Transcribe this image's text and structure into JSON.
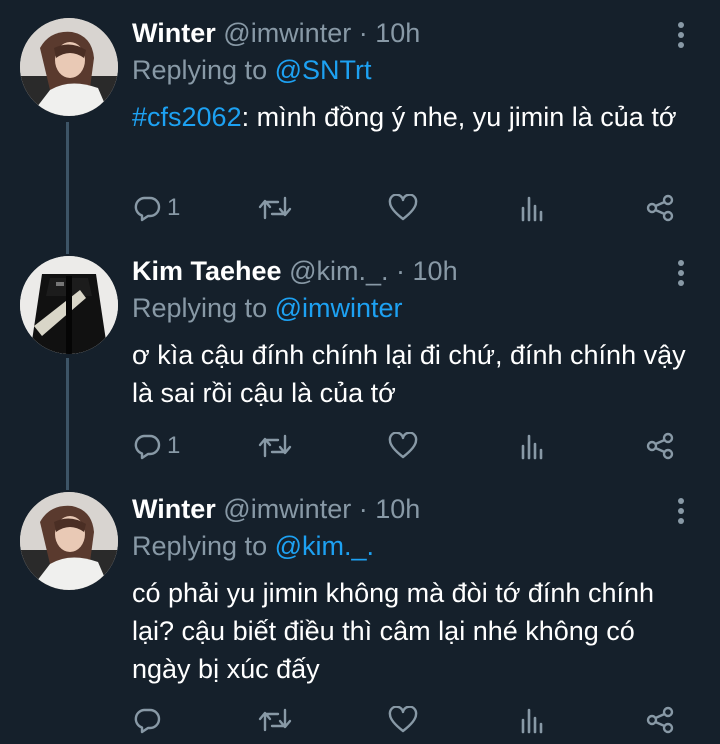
{
  "tweets": [
    {
      "name": "Winter",
      "handle": "@imwinter",
      "dot": "·",
      "time": "10h",
      "replying_prefix": "Replying to ",
      "replying_to": "@SNTrt",
      "hashtag": "#cfs2062",
      "text": ": mình đồng ý nhe, yu jimin là của tớ",
      "reply_count": "1",
      "avatar_icon": "girl-photo"
    },
    {
      "name": "Kim Taehee",
      "handle": "@kim._.",
      "dot": "·",
      "time": "10h",
      "replying_prefix": "Replying to ",
      "replying_to": "@imwinter",
      "text": "ơ kìa cậu đính chính lại đi chứ, đính chính vậy là sai rồi cậu là của tớ",
      "reply_count": "1",
      "avatar_icon": "jacket-photo"
    },
    {
      "name": "Winter",
      "handle": "@imwinter",
      "dot": "·",
      "time": "10h",
      "replying_prefix": "Replying to ",
      "replying_to": "@kim._.",
      "text": "có phải yu jimin không mà đòi tớ đính chính lại? cậu biết điều thì câm lại nhé không có ngày bị xúc đấy",
      "reply_count": "",
      "avatar_icon": "girl-photo"
    }
  ],
  "icons": {
    "reply": "reply-icon",
    "retweet": "retweet-icon",
    "like": "heart-icon",
    "analytics": "analytics-icon",
    "share": "share-icon",
    "more": "more-vertical-icon"
  },
  "colors": {
    "background": "#15202b",
    "text": "#ffffff",
    "secondary": "#8899a6",
    "accent": "#1da1f2",
    "thread_line": "#3d5466"
  }
}
